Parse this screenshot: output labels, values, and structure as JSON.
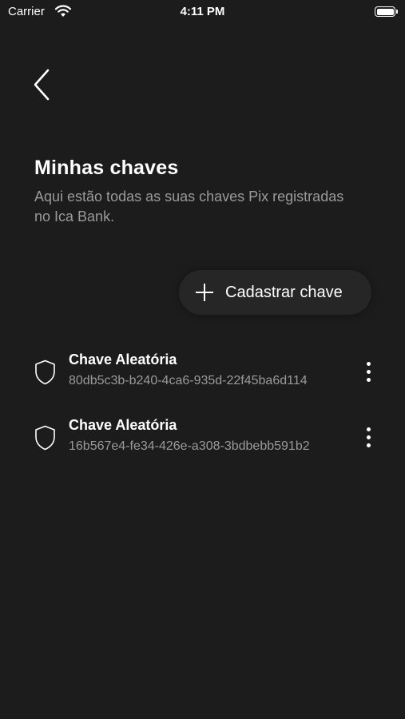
{
  "status_bar": {
    "carrier": "Carrier",
    "time": "4:11 PM"
  },
  "header": {
    "title": "Minhas chaves",
    "subtitle": "Aqui estão todas as suas chaves Pix registradas no Ica Bank."
  },
  "add_key_button": {
    "label": "Cadastrar chave",
    "icon": "plus-icon"
  },
  "keys": [
    {
      "type": "Chave Aleatória",
      "value": "80db5c3b-b240-4ca6-935d-22f45ba6d114",
      "icon": "shield-icon"
    },
    {
      "type": "Chave Aleatória",
      "value": "16b567e4-fe34-426e-a308-3bdbebb591b2",
      "icon": "shield-icon"
    }
  ],
  "colors": {
    "background": "#1c1c1c",
    "text_primary": "#ffffff",
    "text_secondary": "#9a9a9a",
    "button_background": "#262626"
  }
}
